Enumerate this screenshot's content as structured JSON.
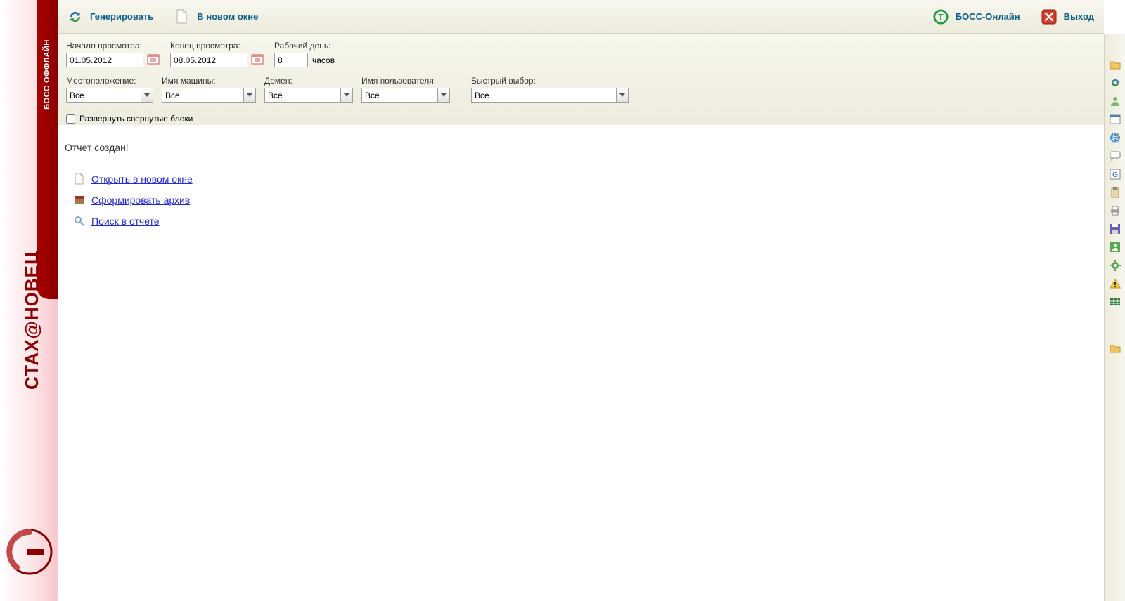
{
  "brand": {
    "sidebar_tab": "БОСС ОФФЛАЙН",
    "vertical_1": "СТАХ",
    "vertical_at": "@",
    "vertical_2": "НОВЕЦ"
  },
  "topbar": {
    "generate": "Генерировать",
    "new_window": "В новом окне",
    "boss_online": "БОСС-Онлайн",
    "exit": "Выход"
  },
  "filters": {
    "start_label": "Начало просмотра:",
    "start_value": "01.05.2012",
    "end_label": "Конец просмотра:",
    "end_value": "08.05.2012",
    "workday_label": "Рабочий день:",
    "workday_value": "8",
    "workday_unit": "часов",
    "location_label": "Местоположение:",
    "machine_label": "Имя машины:",
    "domain_label": "Домен:",
    "user_label": "Имя пользователя:",
    "quick_label": "Быстрый выбор:",
    "option_all": "Все",
    "expand_checkbox": "Развернуть свернутые блоки"
  },
  "content": {
    "message": "Отчет создан!",
    "link_open": "Открыть в новом окне",
    "link_archive": "Сформировать архив",
    "link_search": "Поиск в отчете"
  }
}
